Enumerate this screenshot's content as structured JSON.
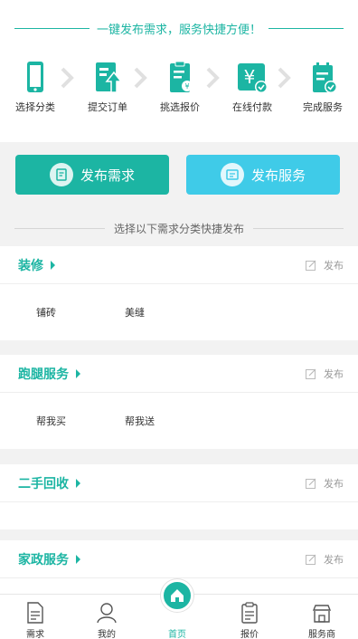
{
  "header": {
    "slogan": "一键发布需求，服务快捷方便！"
  },
  "steps": [
    {
      "label": "选择分类",
      "icon": "phone-icon"
    },
    {
      "label": "提交订单",
      "icon": "submit-order-icon"
    },
    {
      "label": "挑选报价",
      "icon": "quote-icon"
    },
    {
      "label": "在线付款",
      "icon": "payment-icon"
    },
    {
      "label": "完成服务",
      "icon": "complete-icon"
    }
  ],
  "actions": {
    "publish_demand": "发布需求",
    "publish_service": "发布服务"
  },
  "category_hint": "选择以下需求分类快捷发布",
  "publish_label": "发布",
  "categories": [
    {
      "title": "装修",
      "items": [
        "铺砖",
        "美缝"
      ]
    },
    {
      "title": "跑腿服务",
      "items": [
        "帮我买",
        "帮我送"
      ]
    },
    {
      "title": "二手回收",
      "items": []
    },
    {
      "title": "家政服务",
      "items": []
    }
  ],
  "tabbar": [
    {
      "label": "需求",
      "icon": "document-icon"
    },
    {
      "label": "我的",
      "icon": "user-icon"
    },
    {
      "label": "首页",
      "icon": "home-icon"
    },
    {
      "label": "报价",
      "icon": "clipboard-icon"
    },
    {
      "label": "服务商",
      "icon": "store-icon"
    }
  ],
  "colors": {
    "primary": "#1cb5a3",
    "secondary": "#3fcbe8",
    "background": "#f2f2f2"
  }
}
